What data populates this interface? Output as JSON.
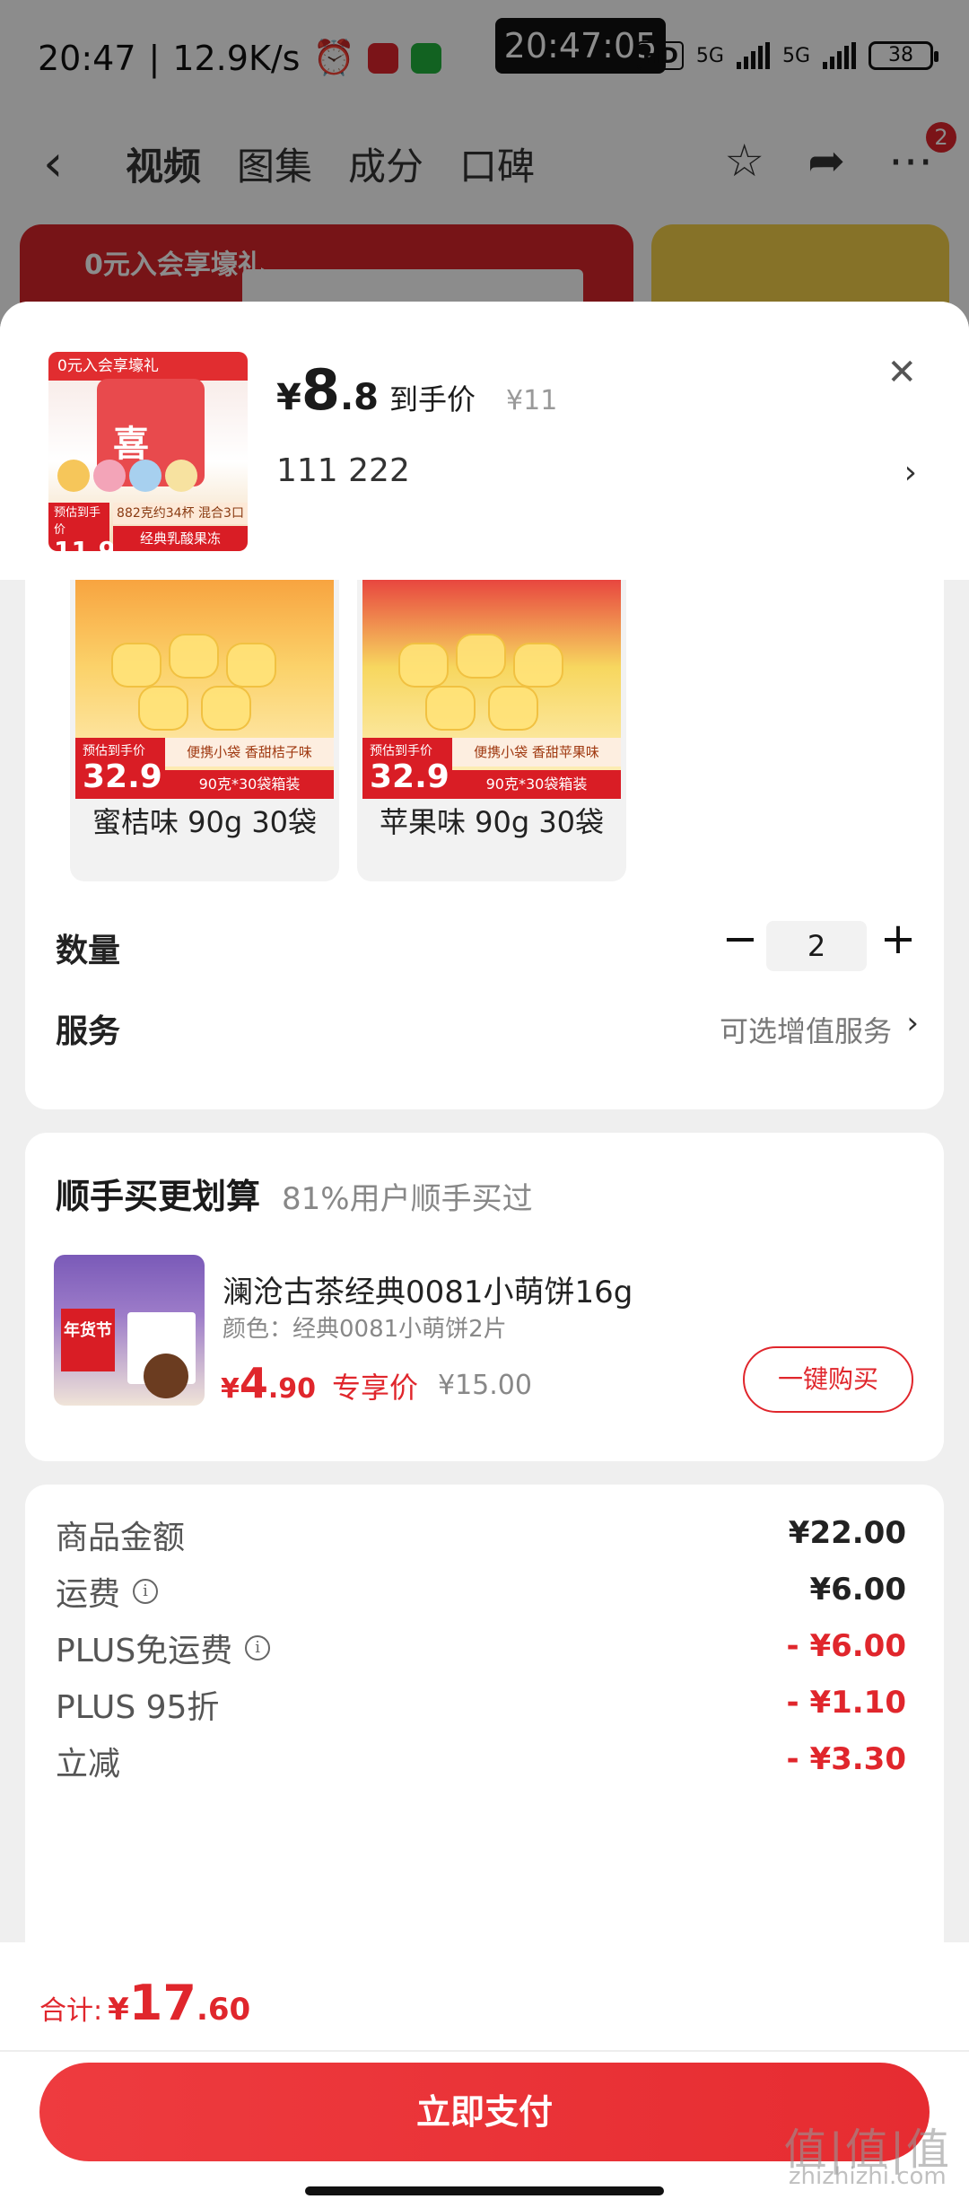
{
  "status_bar": {
    "time": "20:47",
    "speed": "12.9K/s",
    "clock": "20:47:05",
    "hd": "HD",
    "net1": "5G",
    "net2": "5G",
    "battery": "38"
  },
  "nav": {
    "tabs": [
      "视频",
      "图集",
      "成分",
      "口碑"
    ],
    "badge": "2"
  },
  "banner": {
    "text": "0元入会享壕礼"
  },
  "header": {
    "price_symbol": "¥",
    "price_int": "8",
    "price_dec": ".8",
    "price_label": "到手价",
    "original_price": "¥11",
    "spec": "111  222",
    "thumb": {
      "top_text": "0元入会享壕礼",
      "brand": "喜",
      "sub": "乳酸果冻",
      "price_tag": "预估到手价",
      "price": "11.9",
      "desc": "882克约34杯 混合3口味",
      "name": "经典乳酸果冻"
    }
  },
  "flavors": [
    {
      "badge_label": "预估到手价",
      "price": "32.9",
      "tag1": "便携小袋 香甜桔子味",
      "tag2": "90克*30袋箱装",
      "name": "蜜桔味 90g 30袋"
    },
    {
      "badge_label": "预估到手价",
      "price": "32.9",
      "tag1": "便携小袋 香甜苹果味",
      "tag2": "90克*30袋箱装",
      "name": "苹果味 90g 30袋"
    }
  ],
  "quantity": {
    "label": "数量",
    "minus": "−",
    "value": "2",
    "plus": "+"
  },
  "service": {
    "label": "服务",
    "value": "可选增值服务"
  },
  "upsell": {
    "title": "顺手买更划算",
    "subtitle": "81%用户顺手买过",
    "name": "澜沧古茶经典0081小萌饼16g",
    "color": "颜色：经典0081小萌饼2片",
    "price_symbol": "¥",
    "price_int": "4",
    "price_dec": ".90",
    "price_label": "专享价",
    "original_price": "¥15.00",
    "button": "一键购买",
    "img_tag": "年货节"
  },
  "breakdown": [
    {
      "label": "商品金额",
      "value": "¥22.00",
      "info": false,
      "red": false
    },
    {
      "label": "运费",
      "value": "¥6.00",
      "info": true,
      "red": false
    },
    {
      "label": "PLUS免运费",
      "value": "- ¥6.00",
      "info": true,
      "red": true
    },
    {
      "label": "PLUS 95折",
      "value": "- ¥1.10",
      "info": false,
      "red": true
    },
    {
      "label": "立减",
      "value": "- ¥3.30",
      "info": false,
      "red": true
    }
  ],
  "total": {
    "label": "合计:",
    "symbol": "¥",
    "int": "17",
    "dec": ".60"
  },
  "pay_button": "立即支付",
  "watermark": {
    "big": "值|值|值",
    "small": "zhizhizhi.com"
  },
  "colors": {
    "accent": "#e0262c",
    "button": "#ee3b3f"
  }
}
